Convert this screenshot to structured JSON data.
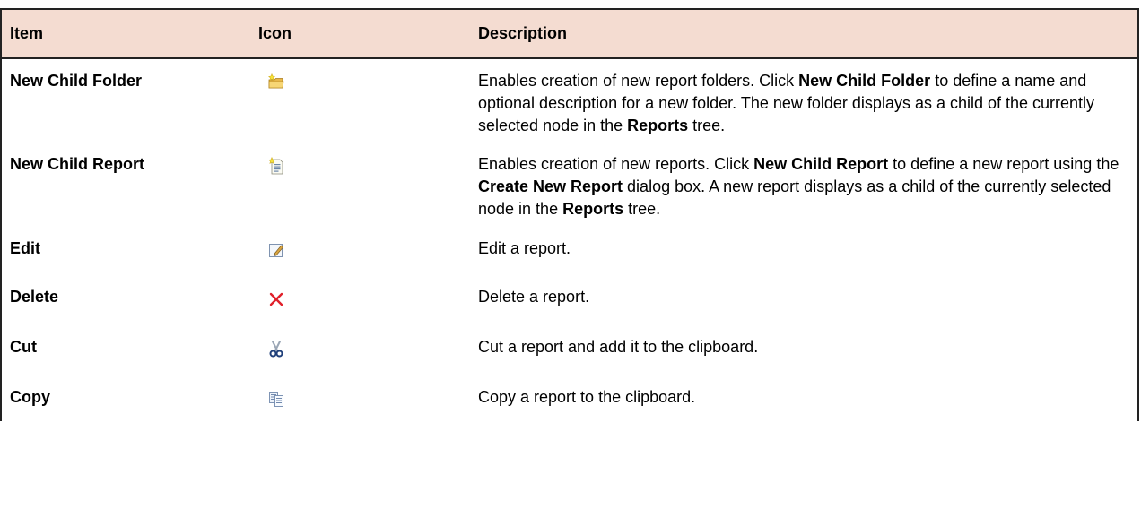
{
  "table": {
    "headers": {
      "item": "Item",
      "icon": "Icon",
      "description": "Description"
    },
    "header_bg": "#f4dcd1",
    "rows": [
      {
        "item": "New Child Folder",
        "icon": "new-folder-icon",
        "desc": [
          {
            "t": "Enables creation of new report folders. Click "
          },
          {
            "b": "New Child Folder"
          },
          {
            "t": " to define a name and optional description for a new folder. The new folder displays as a child of the currently selected node in the "
          },
          {
            "b": "Reports"
          },
          {
            "t": " tree."
          }
        ]
      },
      {
        "item": "New Child Report",
        "icon": "new-report-icon",
        "desc": [
          {
            "t": "Enables creation of new reports. Click "
          },
          {
            "b": "New Child Report"
          },
          {
            "t": " to define a new report using the "
          },
          {
            "b": "Create New Report"
          },
          {
            "t": " dialog box. A new report displays as a child of the currently selected node in the "
          },
          {
            "b": "Reports"
          },
          {
            "t": " tree."
          }
        ]
      },
      {
        "item": "Edit",
        "icon": "edit-icon",
        "desc": [
          {
            "t": "Edit a report."
          }
        ]
      },
      {
        "item": "Delete",
        "icon": "delete-icon",
        "desc": [
          {
            "t": "Delete a report."
          }
        ]
      },
      {
        "item": "Cut",
        "icon": "cut-icon",
        "desc": [
          {
            "t": "Cut a report and add it to the clipboard."
          }
        ]
      },
      {
        "item": "Copy",
        "icon": "copy-icon",
        "desc": [
          {
            "t": "Copy a report to the clipboard."
          }
        ]
      }
    ]
  }
}
